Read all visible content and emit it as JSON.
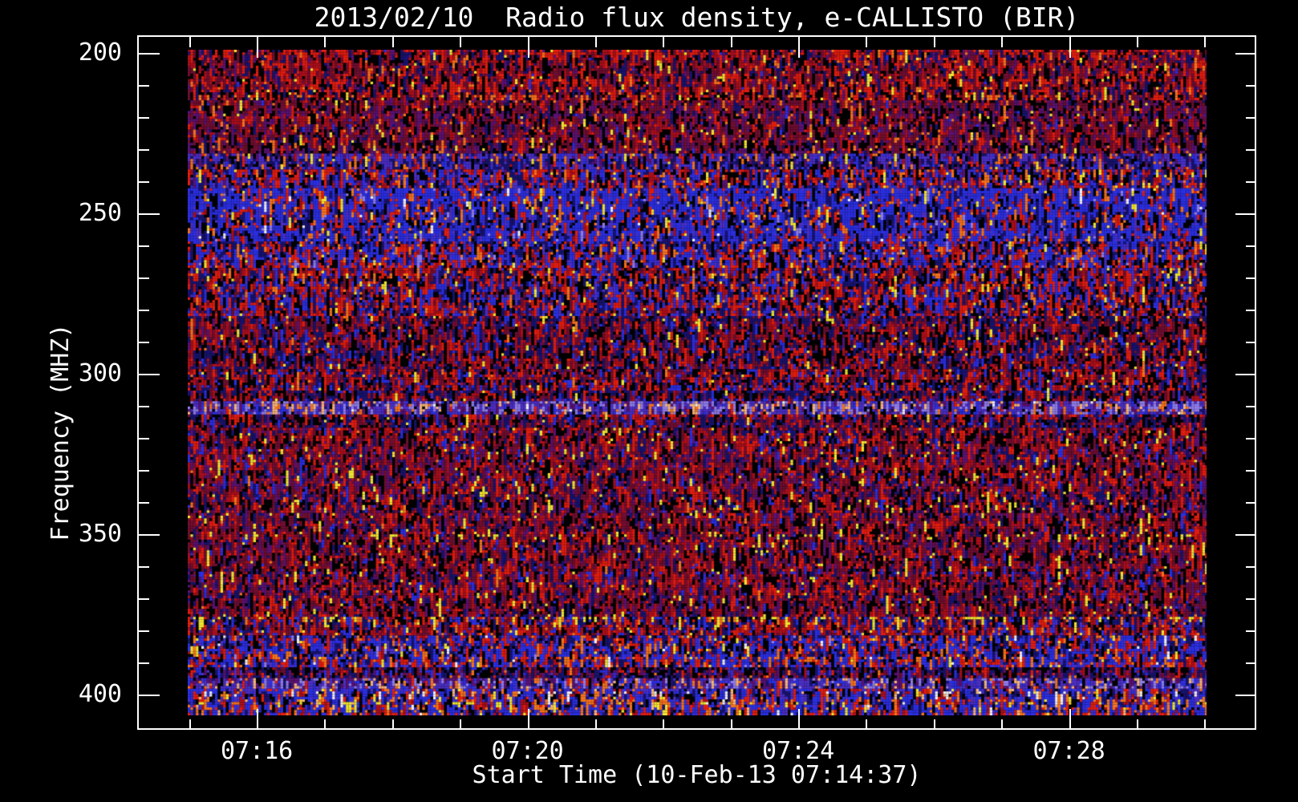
{
  "title": "2013/02/10  Radio flux density, e-CALLISTO (BIR)",
  "chart_data": {
    "type": "heatmap",
    "title": "2013/02/10  Radio flux density, e-CALLISTO (BIR)",
    "date": "2013/02/10",
    "instrument": "e-CALLISTO (BIR)",
    "xlabel": "Start Time (10-Feb-13 07:14:37)",
    "ylabel": "Frequency (MHZ)",
    "x_ticks_major": [
      "07:16",
      "07:20",
      "07:24",
      "07:28"
    ],
    "x_minor_tick_interval": "1 min",
    "y_ticks_major": [
      200,
      250,
      300,
      350,
      400
    ],
    "y_minor_tick_step_mhz": 10,
    "y_axis_direction": "inverted (200 MHz at top, 400 MHz at bottom)",
    "grid": "off",
    "legend": "none",
    "palette": {
      "K": "#000000",
      "N": "#18136e",
      "B": "#2b2fe0",
      "V": "#4b2fc4",
      "L": "#8f7ce8",
      "P": "#5a1272",
      "M": "#6e0e30",
      "C": "#a90f1c",
      "R": "#df1d10",
      "O": "#f4731d",
      "H": "#f7b377",
      "Y": "#efe332",
      "W": "#f2eef2"
    },
    "bands": [
      {
        "f0": 198.5,
        "f1": 215.0,
        "mix": {
          "R": 22,
          "C": 18,
          "M": 16,
          "K": 18,
          "N": 12,
          "P": 6,
          "O": 4,
          "Y": 3,
          "B": 1
        }
      },
      {
        "f0": 215.0,
        "f1": 231.0,
        "mix": {
          "M": 22,
          "P": 20,
          "K": 22,
          "C": 12,
          "R": 8,
          "N": 8,
          "O": 5,
          "Y": 2,
          "B": 1
        }
      },
      {
        "f0": 231.0,
        "f1": 236.5,
        "mix": {
          "V": 24,
          "N": 18,
          "K": 16,
          "P": 10,
          "B": 12,
          "O": 9,
          "R": 6,
          "C": 3,
          "Y": 2
        }
      },
      {
        "f0": 236.5,
        "f1": 242.0,
        "mix": {
          "B": 22,
          "N": 18,
          "K": 16,
          "R": 14,
          "V": 10,
          "C": 8,
          "O": 7,
          "P": 3,
          "Y": 2
        }
      },
      {
        "f0": 242.0,
        "f1": 258.5,
        "mix": {
          "B": 40,
          "N": 14,
          "K": 12,
          "R": 10,
          "V": 8,
          "O": 7,
          "C": 4,
          "Y": 2,
          "W": 1,
          "L": 2
        }
      },
      {
        "f0": 258.5,
        "f1": 267.0,
        "mix": {
          "B": 28,
          "R": 18,
          "N": 14,
          "K": 14,
          "C": 8,
          "V": 7,
          "O": 6,
          "Y": 3,
          "L": 2
        }
      },
      {
        "f0": 267.0,
        "f1": 282.0,
        "mix": {
          "R": 20,
          "B": 16,
          "N": 16,
          "K": 16,
          "C": 12,
          "M": 8,
          "V": 5,
          "O": 4,
          "Y": 3
        }
      },
      {
        "f0": 282.0,
        "f1": 298.5,
        "mix": {
          "N": 20,
          "K": 22,
          "M": 16,
          "C": 14,
          "R": 12,
          "B": 8,
          "P": 5,
          "Y": 2,
          "O": 1
        }
      },
      {
        "f0": 298.5,
        "f1": 305.0,
        "mix": {
          "R": 18,
          "C": 16,
          "K": 18,
          "N": 16,
          "M": 12,
          "B": 10,
          "P": 5,
          "Y": 3,
          "O": 2
        }
      },
      {
        "f0": 305.0,
        "f1": 308.7,
        "mix": {
          "N": 22,
          "K": 24,
          "M": 14,
          "C": 12,
          "R": 10,
          "B": 8,
          "P": 7,
          "Y": 2,
          "V": 1
        }
      },
      {
        "f0": 308.7,
        "f1": 312.3,
        "mix": {
          "L": 26,
          "V": 22,
          "P": 12,
          "K": 10,
          "O": 9,
          "H": 6,
          "B": 6,
          "N": 5,
          "R": 3,
          "W": 1
        }
      },
      {
        "f0": 312.3,
        "f1": 316.5,
        "mix": {
          "N": 22,
          "K": 24,
          "M": 14,
          "C": 12,
          "R": 12,
          "B": 8,
          "P": 6,
          "Y": 2
        }
      },
      {
        "f0": 316.5,
        "f1": 343.5,
        "mix": {
          "M": 20,
          "C": 16,
          "R": 14,
          "K": 18,
          "N": 12,
          "P": 10,
          "B": 5,
          "Y": 4,
          "O": 1
        }
      },
      {
        "f0": 343.5,
        "f1": 376.0,
        "mix": {
          "M": 22,
          "C": 16,
          "R": 12,
          "K": 20,
          "N": 12,
          "P": 10,
          "B": 4,
          "Y": 3,
          "O": 1
        }
      },
      {
        "f0": 376.0,
        "f1": 382.0,
        "mix": {
          "R": 20,
          "C": 14,
          "B": 14,
          "K": 16,
          "N": 14,
          "M": 10,
          "O": 7,
          "Y": 3,
          "V": 2
        }
      },
      {
        "f0": 382.0,
        "f1": 391.5,
        "mix": {
          "B": 34,
          "R": 14,
          "N": 14,
          "K": 12,
          "C": 8,
          "O": 9,
          "V": 5,
          "Y": 2,
          "W": 1,
          "L": 1
        }
      },
      {
        "f0": 391.5,
        "f1": 395.0,
        "mix": {
          "K": 26,
          "N": 24,
          "B": 10,
          "M": 10,
          "P": 10,
          "C": 8,
          "R": 7,
          "V": 3,
          "O": 2
        }
      },
      {
        "f0": 395.0,
        "f1": 398.0,
        "mix": {
          "V": 20,
          "L": 16,
          "P": 14,
          "K": 12,
          "H": 10,
          "O": 8,
          "B": 10,
          "N": 6,
          "R": 4
        }
      },
      {
        "f0": 398.0,
        "f1": 406.8,
        "mix": {
          "B": 32,
          "O": 12,
          "R": 12,
          "K": 12,
          "N": 12,
          "C": 8,
          "V": 6,
          "H": 3,
          "Y": 2,
          "W": 1
        }
      }
    ]
  }
}
